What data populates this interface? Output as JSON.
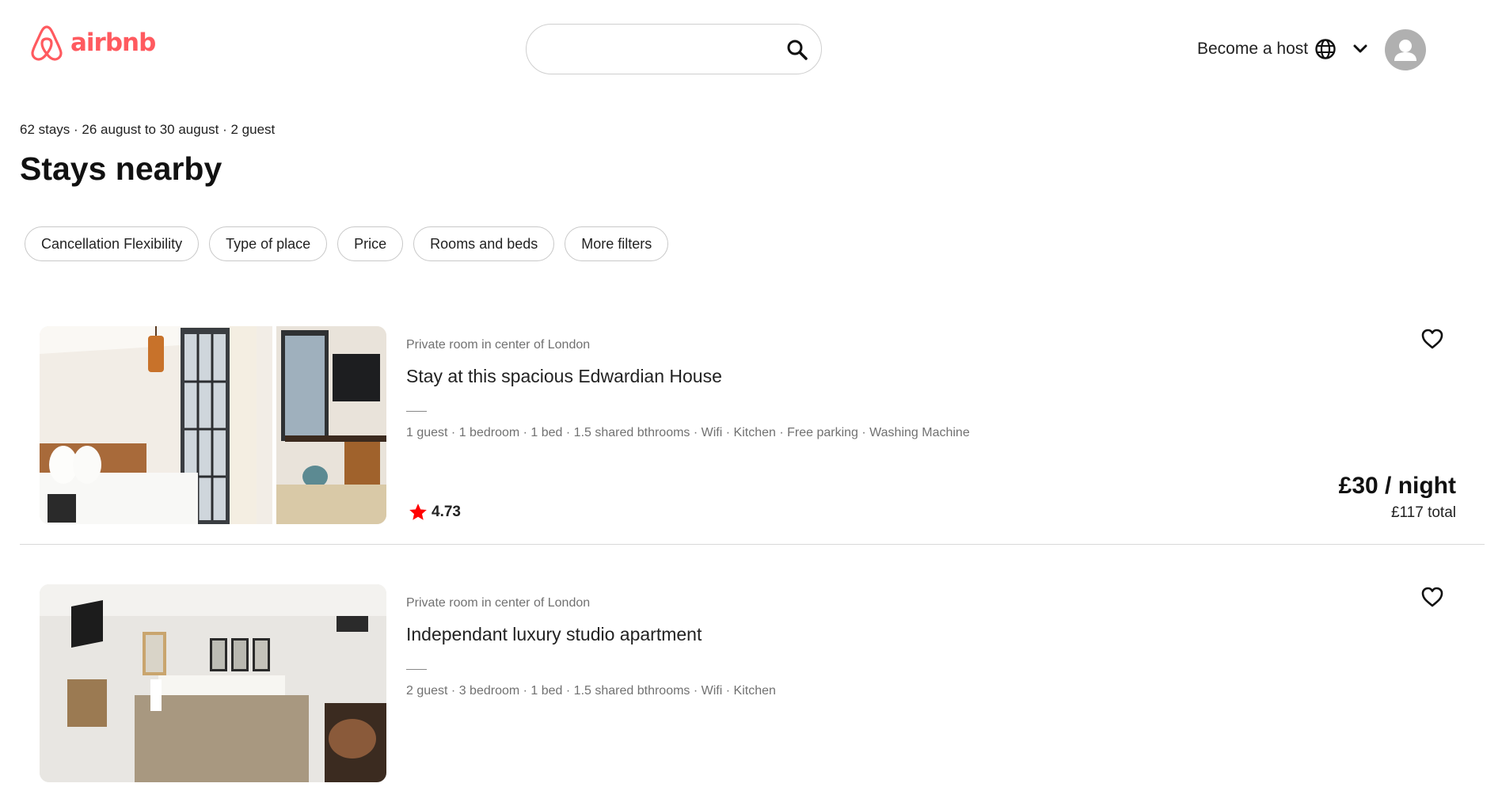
{
  "header": {
    "logo_text": "airbnb",
    "search": {
      "value": "",
      "placeholder": ""
    },
    "host_label": "Become a host"
  },
  "summary": "62 stays · 26 august to 30 august · 2 guest",
  "page_title": "Stays nearby",
  "filters": [
    "Cancellation Flexibility",
    "Type of place",
    "Price",
    "Rooms and beds",
    "More filters"
  ],
  "listings": [
    {
      "type": "Private room in center of London",
      "title": "Stay at this spacious Edwardian House",
      "amenities": "1 guest · 1 bedroom · 1 bed · 1.5 shared bthrooms · Wifi · Kitchen · Free parking · Washing Machine",
      "rating": "4.73",
      "price": "£30 / night",
      "total": "£117 total"
    },
    {
      "type": "Private room in center of London",
      "title": "Independant luxury studio apartment",
      "amenities": "2 guest · 3 bedroom · 1 bed · 1.5 shared bthrooms · Wifi · Kitchen"
    }
  ],
  "colors": {
    "brand": "#ff5a5f",
    "rating_star": "#ff0000"
  },
  "icons": [
    "airbnb-logo-icon",
    "search-icon",
    "globe-icon",
    "chevron-down-icon",
    "user-avatar-icon",
    "heart-icon",
    "star-icon"
  ]
}
